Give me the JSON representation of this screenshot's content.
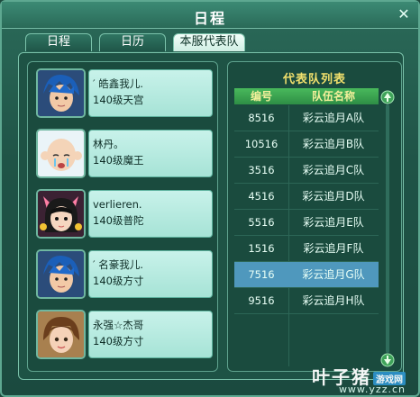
{
  "window": {
    "title": "日程"
  },
  "tabs": [
    {
      "label": "日程"
    },
    {
      "label": "日历"
    },
    {
      "label": "本服代表队"
    }
  ],
  "members": [
    {
      "name": "′ 皓鑫我儿.",
      "level_class": "140级天宫"
    },
    {
      "name": "林丹。",
      "level_class": "140级魔王"
    },
    {
      "name": "verlieren.",
      "level_class": "140级普陀"
    },
    {
      "name": "′ 名豪我儿.",
      "level_class": "140级方寸"
    },
    {
      "name": "永强☆杰哥",
      "level_class": "140级方寸"
    }
  ],
  "team_list": {
    "title": "代表队列表",
    "columns": {
      "id": "编号",
      "name": "队伍名称"
    },
    "rows": [
      {
        "id": "8516",
        "name": "彩云追月A队"
      },
      {
        "id": "10516",
        "name": "彩云追月B队"
      },
      {
        "id": "3516",
        "name": "彩云追月C队"
      },
      {
        "id": "4516",
        "name": "彩云追月D队"
      },
      {
        "id": "5516",
        "name": "彩云追月E队"
      },
      {
        "id": "1516",
        "name": "彩云追月F队"
      },
      {
        "id": "7516",
        "name": "彩云追月G队"
      },
      {
        "id": "9516",
        "name": "彩云追月H队"
      }
    ],
    "selected_row": 6
  },
  "watermark": {
    "brand": "叶子猪",
    "tag": "游戏网",
    "url": "www.yzz.cn"
  },
  "icons": {
    "close": "close-icon",
    "scroll_up": "scroll-up-arrow-icon",
    "scroll_down": "scroll-down-arrow-icon"
  },
  "colors": {
    "selected_row": "#4f98bd",
    "header_bg": "#3aa552",
    "title_gold": "#f1e06c"
  }
}
